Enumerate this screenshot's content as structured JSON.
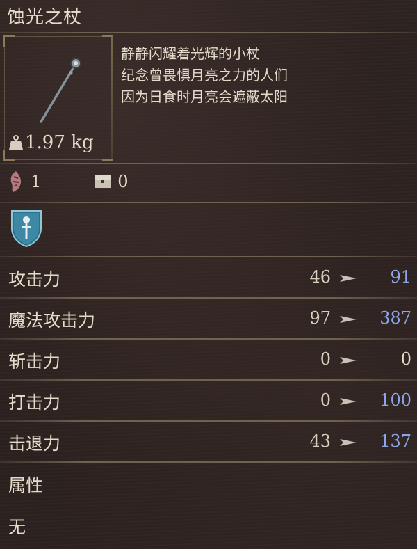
{
  "title": "蚀光之杖",
  "description": [
    "静静闪耀着光辉的小杖",
    "纪念曾畏惧月亮之力的人们",
    "因为日食时月亮会遮蔽太阳"
  ],
  "weight": "1.97 kg",
  "requirement_value": "1",
  "storage_value": "0",
  "stats": [
    {
      "label": "攻击力",
      "base": "46",
      "new": "91",
      "changed": true
    },
    {
      "label": "魔法攻击力",
      "base": "97",
      "new": "387",
      "changed": true
    },
    {
      "label": "斩击力",
      "base": "0",
      "new": "0",
      "changed": false
    },
    {
      "label": "打击力",
      "base": "0",
      "new": "100",
      "changed": true
    },
    {
      "label": "击退力",
      "base": "43",
      "new": "137",
      "changed": true
    }
  ],
  "attribute": {
    "label": "属性",
    "value": "无"
  },
  "icons": {
    "weight": "weight-icon",
    "requirement": "rune-icon",
    "storage": "chest-icon",
    "skill": "shield-staff-icon",
    "arrow": "arrow-right-icon"
  },
  "colors": {
    "changed_value": "#8aa6e6",
    "text": "#e4dccb"
  }
}
